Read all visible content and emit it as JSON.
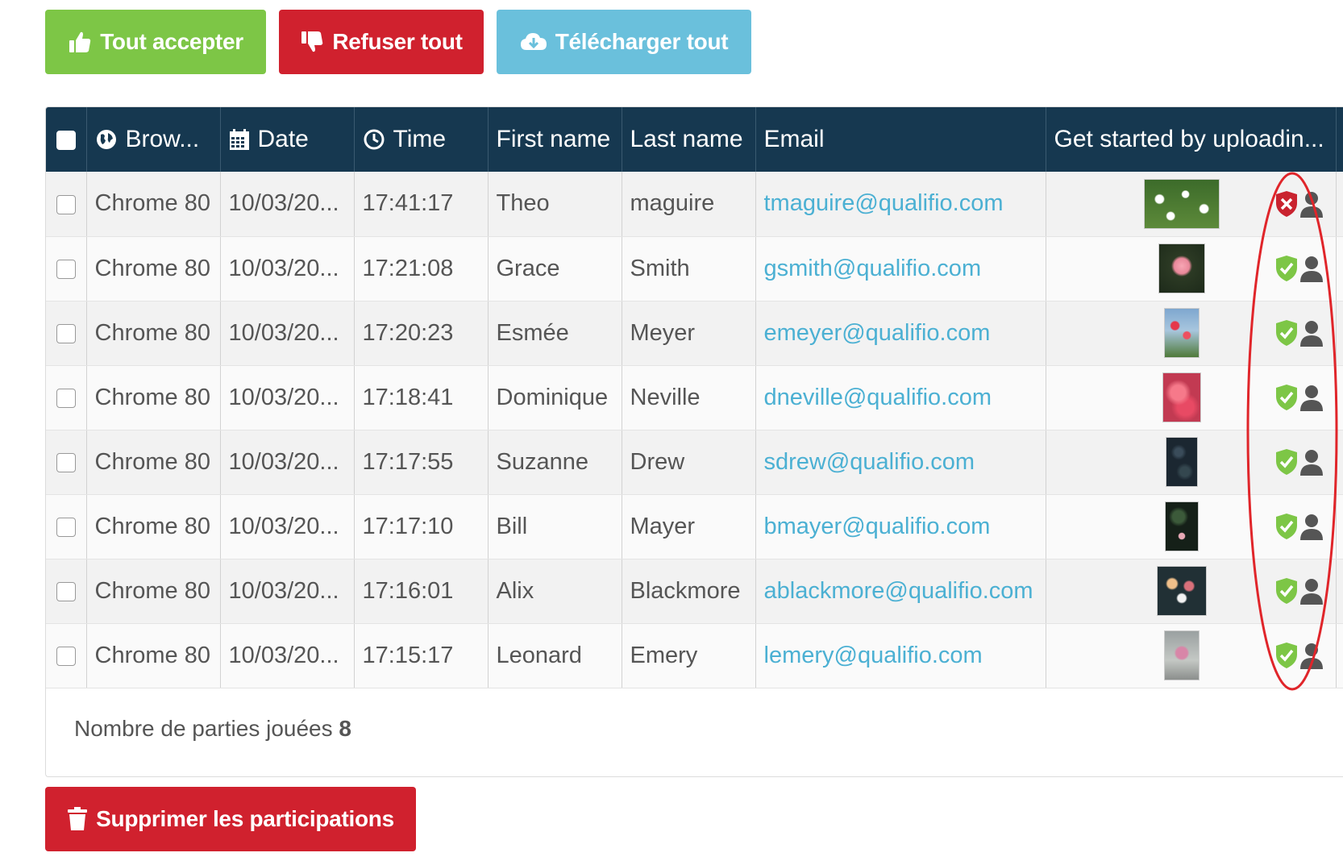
{
  "actions": {
    "accept_all": "Tout accepter",
    "refuse_all": "Refuser tout",
    "download_all": "Télécharger tout",
    "delete": "Supprimer les participations"
  },
  "table": {
    "columns": [
      "Brow...",
      "Date",
      "Time",
      "First name",
      "Last name",
      "Email",
      "Get started by uploadin..."
    ],
    "rows": [
      {
        "browser": "Chrome 80",
        "date": "10/03/20...",
        "time": "17:41:17",
        "first": "Theo",
        "last": "maguire",
        "email": "tmaguire@qualifio.com",
        "status": "refused",
        "thumb": "daisies"
      },
      {
        "browser": "Chrome 80",
        "date": "10/03/20...",
        "time": "17:21:08",
        "first": "Grace",
        "last": "Smith",
        "email": "gsmith@qualifio.com",
        "status": "accepted",
        "thumb": "rose"
      },
      {
        "browser": "Chrome 80",
        "date": "10/03/20...",
        "time": "17:20:23",
        "first": "Esmée",
        "last": "Meyer",
        "email": "emeyer@qualifio.com",
        "status": "accepted",
        "thumb": "tulips"
      },
      {
        "browser": "Chrome 80",
        "date": "10/03/20...",
        "time": "17:18:41",
        "first": "Dominique",
        "last": "Neville",
        "email": "dneville@qualifio.com",
        "status": "accepted",
        "thumb": "pink-flowers"
      },
      {
        "browser": "Chrome 80",
        "date": "10/03/20...",
        "time": "17:17:55",
        "first": "Suzanne",
        "last": "Drew",
        "email": "sdrew@qualifio.com",
        "status": "accepted",
        "thumb": "dark-leaves"
      },
      {
        "browser": "Chrome 80",
        "date": "10/03/20...",
        "time": "17:17:10",
        "first": "Bill",
        "last": "Mayer",
        "email": "bmayer@qualifio.com",
        "status": "accepted",
        "thumb": "lily-pads"
      },
      {
        "browser": "Chrome 80",
        "date": "10/03/20...",
        "time": "17:16:01",
        "first": "Alix",
        "last": "Blackmore",
        "email": "ablackmore@qualifio.com",
        "status": "accepted",
        "thumb": "bouquet"
      },
      {
        "browser": "Chrome 80",
        "date": "10/03/20...",
        "time": "17:15:17",
        "first": "Leonard",
        "last": "Emery",
        "email": "lemery@qualifio.com",
        "status": "accepted",
        "thumb": "vase"
      }
    ]
  },
  "footer": {
    "played_label": "Nombre de parties jouées",
    "played_count": "8"
  },
  "colors": {
    "accept": "#7dc646",
    "refuse": "#d0212e",
    "download": "#6ac0dc",
    "header_bg": "#163850",
    "link": "#4bb0d3",
    "highlight": "#e0252a"
  },
  "icons": {
    "accept": "thumbs-up-icon",
    "refuse": "thumbs-down-icon",
    "download": "cloud-download-icon",
    "delete": "trash-icon",
    "browser": "globe-icon",
    "date": "calendar-icon",
    "time": "clock-icon",
    "accepted": "shield-check-icon",
    "refused": "shield-x-icon",
    "user": "user-icon"
  }
}
